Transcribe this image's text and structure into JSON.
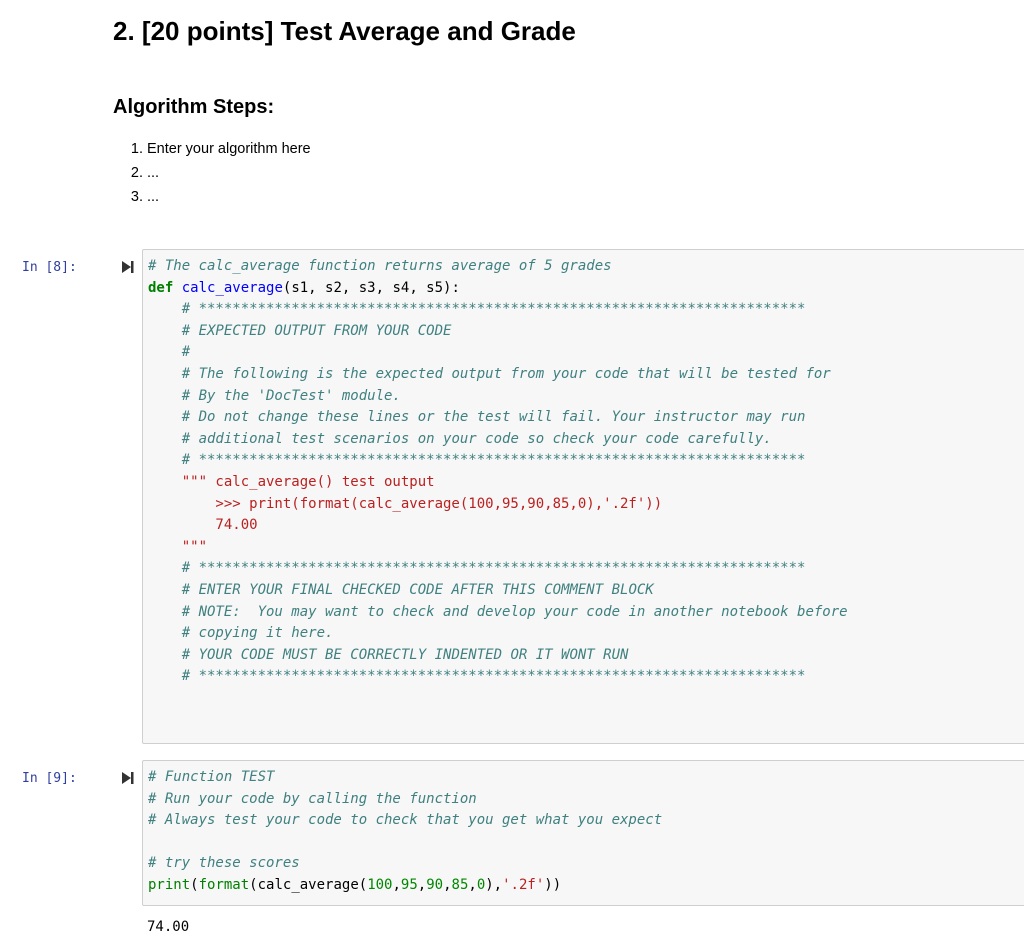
{
  "title": "2. [20 points] Test Average and Grade",
  "algorithm_heading": "Algorithm Steps:",
  "algorithm_steps": [
    "Enter your algorithm here",
    "...",
    "..."
  ],
  "cells": [
    {
      "prompt": "In [8]:",
      "lines": [
        "# The calc_average function returns average of 5 grades",
        "def calc_average(s1, s2, s3, s4, s5):",
        "    # ************************************************************************",
        "    # EXPECTED OUTPUT FROM YOUR CODE",
        "    #",
        "    # The following is the expected output from your code that will be tested for",
        "    # By the 'DocTest' module.",
        "    # Do not change these lines or the test will fail. Your instructor may run",
        "    # additional test scenarios on your code so check your code carefully.",
        "    # ************************************************************************",
        "    \"\"\" calc_average() test output",
        "        >>> print(format(calc_average(100,95,90,85,0),'.2f'))",
        "        74.00",
        "    \"\"\"",
        "    # ************************************************************************",
        "    # ENTER YOUR FINAL CHECKED CODE AFTER THIS COMMENT BLOCK",
        "    # NOTE:  You may want to check and develop your code in another notebook before",
        "    # copying it here.",
        "    # YOUR CODE MUST BE CORRECTLY INDENTED OR IT WONT RUN",
        "    # ************************************************************************",
        "",
        ""
      ]
    },
    {
      "prompt": "In [9]:",
      "lines": [
        "# Function TEST",
        "# Run your code by calling the function",
        "# Always test your code to check that you get what you expect",
        "",
        "# try these scores",
        "print(format(calc_average(100,95,90,85,0),'.2f'))"
      ],
      "output": "74.00"
    }
  ],
  "colors": {
    "comment": "#408080",
    "keyword": "#008000",
    "function_name": "#0000ff",
    "string": "#ba2121",
    "number": "#008800",
    "prompt": "#303f9f",
    "cell_background": "#f7f7f7",
    "cell_border": "#cfcfcf"
  },
  "icons": {
    "run_cell": "step-forward-icon"
  }
}
